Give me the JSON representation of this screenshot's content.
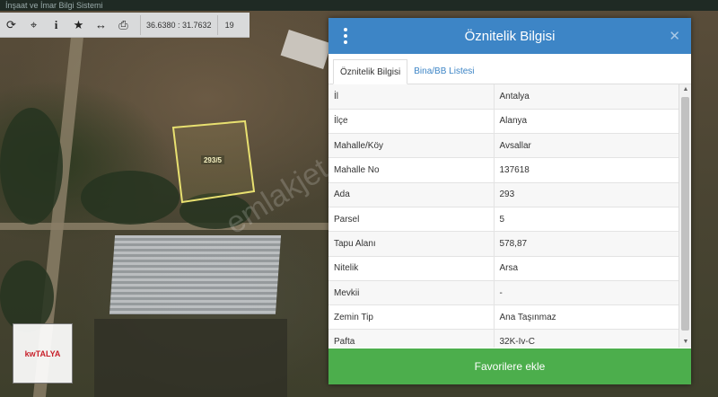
{
  "topbar": {
    "text": "İnşaat ve İmar Bilgi Sistemi"
  },
  "toolbar": {
    "buttons": [
      {
        "icon": "refresh-icon",
        "glyph": "⟳"
      },
      {
        "icon": "crosshair-icon",
        "glyph": "⌖"
      },
      {
        "icon": "info-icon",
        "glyph": "i"
      },
      {
        "icon": "star-icon",
        "glyph": "★"
      },
      {
        "icon": "measure-icon",
        "glyph": "↔"
      },
      {
        "icon": "print-icon",
        "glyph": "⎙"
      }
    ],
    "coordinates": "36.6380 : 31.7632",
    "zoom": "19"
  },
  "map": {
    "parcel_label": "293/5",
    "watermark": "emlakjet.com",
    "logo_text": "kwTALYA"
  },
  "panel": {
    "title": "Öznitelik Bilgisi",
    "tabs": [
      {
        "label": "Öznitelik Bilgisi",
        "active": true
      },
      {
        "label": "Bina/BB Listesi",
        "active": false
      }
    ],
    "rows": [
      {
        "key": "İl",
        "value": "Antalya"
      },
      {
        "key": "İlçe",
        "value": "Alanya"
      },
      {
        "key": "Mahalle/Köy",
        "value": "Avsallar"
      },
      {
        "key": "Mahalle No",
        "value": "137618"
      },
      {
        "key": "Ada",
        "value": "293"
      },
      {
        "key": "Parsel",
        "value": "5"
      },
      {
        "key": "Tapu Alanı",
        "value": "578,87"
      },
      {
        "key": "Nitelik",
        "value": "Arsa"
      },
      {
        "key": "Mevkii",
        "value": "-"
      },
      {
        "key": "Zemin Tip",
        "value": "Ana Taşınmaz"
      },
      {
        "key": "Pafta",
        "value": "32K-Iv-C"
      }
    ],
    "favorite_button": "Favorilere ekle"
  },
  "colors": {
    "header": "#3d85c6",
    "button": "#4cae4c",
    "parcel_outline": "#e8e070"
  }
}
